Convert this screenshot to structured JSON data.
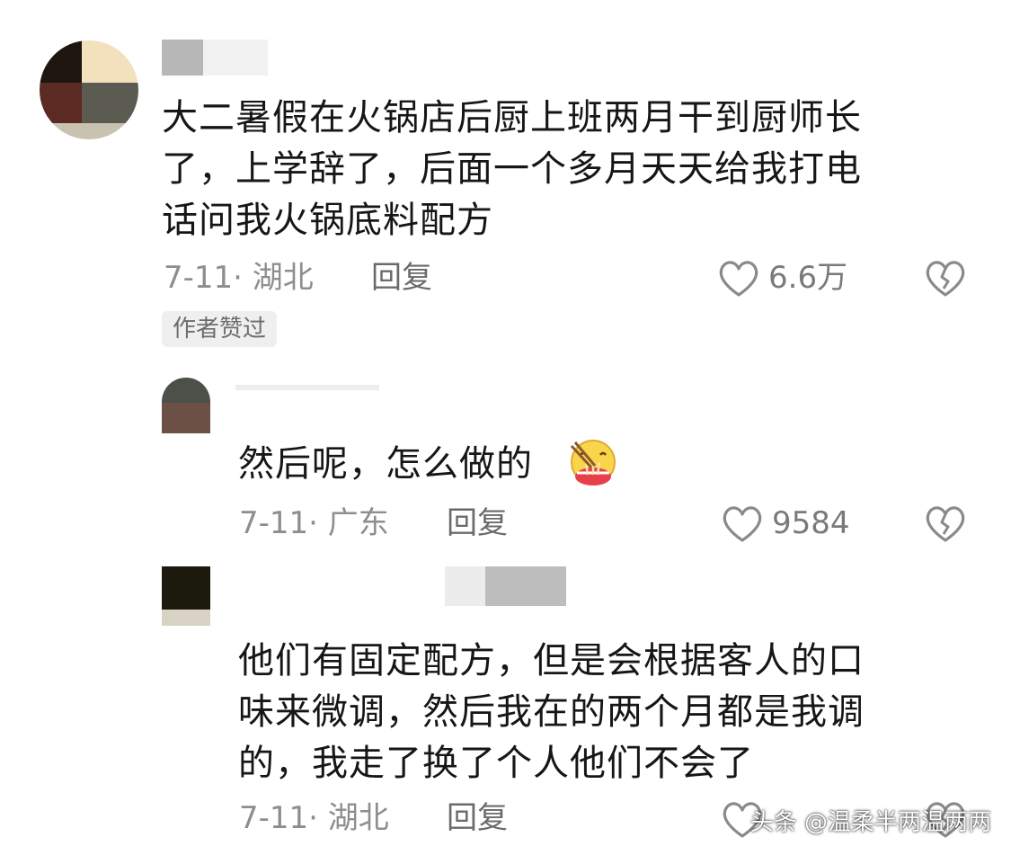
{
  "comments": [
    {
      "text_lines": [
        "大二暑假在火锅店后厨上班两月干到厨师长",
        "了，上学辞了，后面一个多月天天给我打电",
        "话问我火锅底料配方"
      ],
      "date_location": "7-11· 湖北",
      "reply_label": "回复",
      "likes": "6.6万",
      "badge": "作者赞过",
      "icons": {
        "like": "heart-outline-icon",
        "dislike": "broken-heart-icon"
      }
    },
    {
      "text": "然后呢，怎么做的",
      "emoji": "eating-noodles-emoji",
      "date_location": "7-11· 广东",
      "reply_label": "回复",
      "likes": "9584",
      "icons": {
        "like": "heart-outline-icon",
        "dislike": "broken-heart-icon"
      }
    },
    {
      "text_lines": [
        "他们有固定配方，但是会根据客人的口",
        "味来微调，然后我在的两个月都是我调",
        "的，我走了换了个人他们不会了"
      ],
      "date_location": "7-11· 湖北",
      "reply_label": "回复",
      "icons": {
        "like": "heart-outline-icon",
        "dislike": "broken-heart-icon"
      }
    }
  ],
  "watermark": "头条 @温柔半两温两两",
  "colors": {
    "text": "#161616",
    "meta": "#8e8e8e",
    "badge_bg": "#efefef",
    "icon": "#8a8a8a"
  }
}
